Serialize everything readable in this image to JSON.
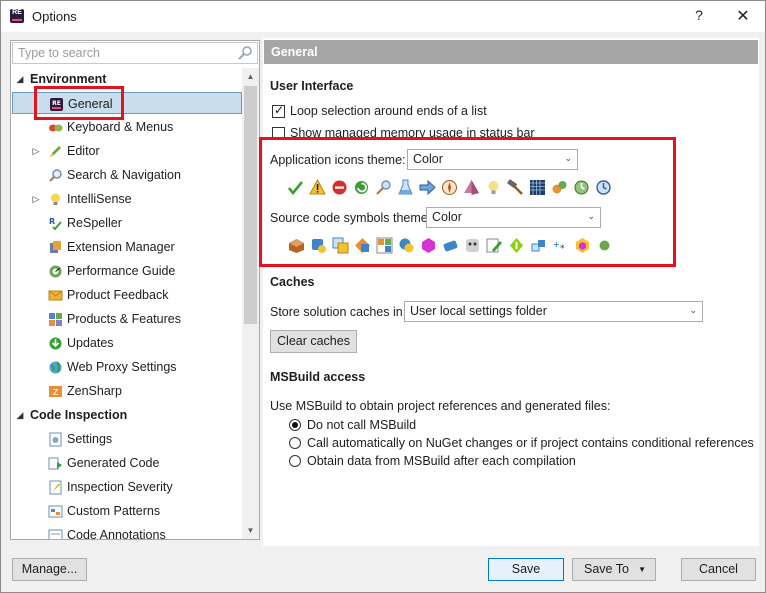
{
  "window": {
    "title": "Options",
    "help": "?",
    "close": "✕"
  },
  "search": {
    "placeholder": "Type to search"
  },
  "tree": [
    {
      "type": "group",
      "label": "Environment",
      "expanded": true
    },
    {
      "type": "item",
      "label": "General",
      "icon": "resharper-icon",
      "selected": true
    },
    {
      "type": "item",
      "label": "Keyboard & Menus",
      "icon": "keyboard-icon"
    },
    {
      "type": "item",
      "label": "Editor",
      "icon": "pencil-icon",
      "expander": true
    },
    {
      "type": "item",
      "label": "Search & Navigation",
      "icon": "magnifier-icon"
    },
    {
      "type": "item",
      "label": "IntelliSense",
      "icon": "lightbulb-icon",
      "expander": true
    },
    {
      "type": "item",
      "label": "ReSpeller",
      "icon": "spellcheck-icon"
    },
    {
      "type": "item",
      "label": "Extension Manager",
      "icon": "extension-icon"
    },
    {
      "type": "item",
      "label": "Performance Guide",
      "icon": "performance-icon"
    },
    {
      "type": "item",
      "label": "Product Feedback",
      "icon": "envelope-icon"
    },
    {
      "type": "item",
      "label": "Products & Features",
      "icon": "products-icon"
    },
    {
      "type": "item",
      "label": "Updates",
      "icon": "updates-icon"
    },
    {
      "type": "item",
      "label": "Web Proxy Settings",
      "icon": "globe-icon"
    },
    {
      "type": "item",
      "label": "ZenSharp",
      "icon": "zensharp-icon"
    },
    {
      "type": "group",
      "label": "Code Inspection",
      "expanded": true
    },
    {
      "type": "item",
      "label": "Settings",
      "icon": "settings-icon"
    },
    {
      "type": "item",
      "label": "Generated Code",
      "icon": "generated-code-icon"
    },
    {
      "type": "item",
      "label": "Inspection Severity",
      "icon": "severity-icon"
    },
    {
      "type": "item",
      "label": "Custom Patterns",
      "icon": "patterns-icon"
    },
    {
      "type": "item",
      "label": "Code Annotations",
      "icon": "annotations-icon"
    }
  ],
  "page": {
    "title": "General",
    "ui_group": "User Interface",
    "loop_selection_label": "Loop selection around ends of a list",
    "loop_selection_checked": true,
    "show_memory_label": "Show managed memory usage in status bar",
    "show_memory_checked": false,
    "app_icons_theme_label": "Application icons theme:",
    "app_icons_theme_value": "Color",
    "source_symbols_theme_label": "Source code symbols theme:",
    "source_symbols_theme_value": "Color",
    "caches_group": "Caches",
    "store_caches_label": "Store solution caches in:",
    "store_caches_value": "User local settings folder",
    "clear_caches_label": "Clear caches",
    "msbuild_group": "MSBuild access",
    "msbuild_desc": "Use MSBuild to obtain project references and generated files:",
    "msbuild_options": [
      {
        "label": "Do not call MSBuild",
        "selected": true
      },
      {
        "label": "Call automatically on NuGet changes or if project contains conditional references",
        "selected": false
      },
      {
        "label": "Obtain data from MSBuild after each compilation",
        "selected": false
      }
    ]
  },
  "app_icons": [
    "check-icon",
    "warning-icon",
    "error-icon",
    "refresh-icon",
    "find-usages-icon",
    "flask-icon",
    "navigate-icon",
    "compass-icon",
    "cone-icon",
    "bulb-icon",
    "hammer-icon",
    "grid-icon",
    "gears-icon",
    "history-icon",
    "clock-icon"
  ],
  "source_icons": [
    "namespace-icon",
    "class-icon",
    "interface-icon",
    "struct-icon",
    "enum-icon",
    "delegate-icon",
    "method-icon",
    "field-icon",
    "event-icon",
    "property-icon",
    "operator-icon",
    "constructor-icon",
    "constant-icon",
    "parameter-icon",
    "variable-icon"
  ],
  "buttons": {
    "manage": "Manage...",
    "save": "Save",
    "save_to": "Save To",
    "cancel": "Cancel"
  },
  "colors": {
    "banner": "#a6a6a6",
    "selection": "#c9deec",
    "highlight": "#e0141e",
    "primary_border": "#0078d7"
  }
}
